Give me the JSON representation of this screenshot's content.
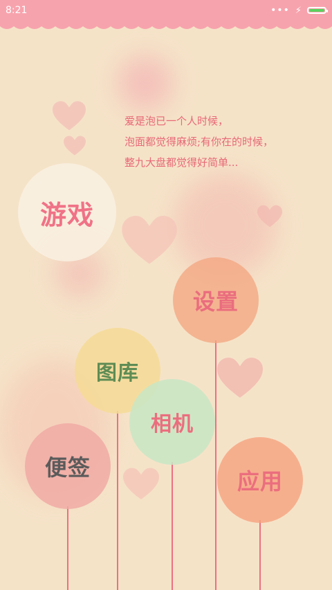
{
  "status_bar": {
    "time": "8:21",
    "overflow_indicator": "•••",
    "charging_icon": "⚡",
    "battery_level": 1.0
  },
  "quote": {
    "line1": "爱是泡已一个人时候，",
    "line2": "泡面都觉得麻烦;有你在的时候，",
    "line3": "整九大盘都觉得好简单..."
  },
  "bubbles": {
    "game": "游戏",
    "settings": "设置",
    "gallery": "图库",
    "camera": "相机",
    "notes": "便签",
    "apps": "应用"
  },
  "colors": {
    "background": "#f5e3c8",
    "status_bar": "#f7a3ad",
    "accent_pink": "#ed6f82",
    "battery_green": "#59d25f"
  }
}
